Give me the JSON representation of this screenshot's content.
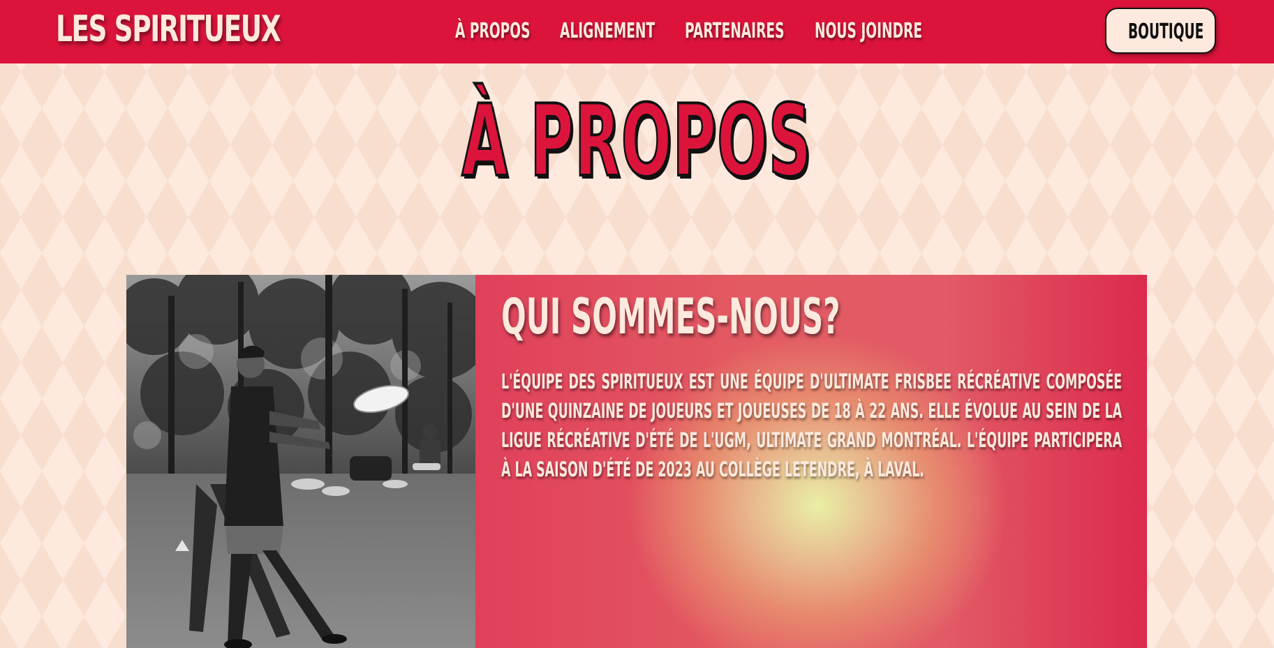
{
  "navbar": {
    "brand": "LES SPIRITUEUX",
    "links": [
      "À PROPOS",
      "ALIGNEMENT",
      "PARTENAIRES",
      "NOUS JOINDRE"
    ],
    "shop_label": "BOUTIQUE"
  },
  "page": {
    "title": "À PROPOS"
  },
  "about": {
    "heading": "QUI SOMMES-NOUS?",
    "body": "L'ÉQUIPE DES SPIRITUEUX EST UNE ÉQUIPE D'ULTIMATE FRISBEE RÉCRÉATIVE COMPOSÉE D'UNE QUINZAINE DE JOUEURS ET JOUEUSES DE 18 À 22 ANS. ELLE ÉVOLUE AU SEIN DE LA LIGUE RÉCRÉATIVE D'ÉTÉ DE L'UGM, ULTIMATE GRAND MONTRÉAL. L'ÉQUIPE PARTICIPERA À LA SAISON D'ÉTÉ DE 2023 AU COLLÈGE LETENDRE, À LAVAL."
  },
  "colors": {
    "brand_red": "#dc143c",
    "cream": "#fde9dd",
    "outline": "#111111"
  }
}
